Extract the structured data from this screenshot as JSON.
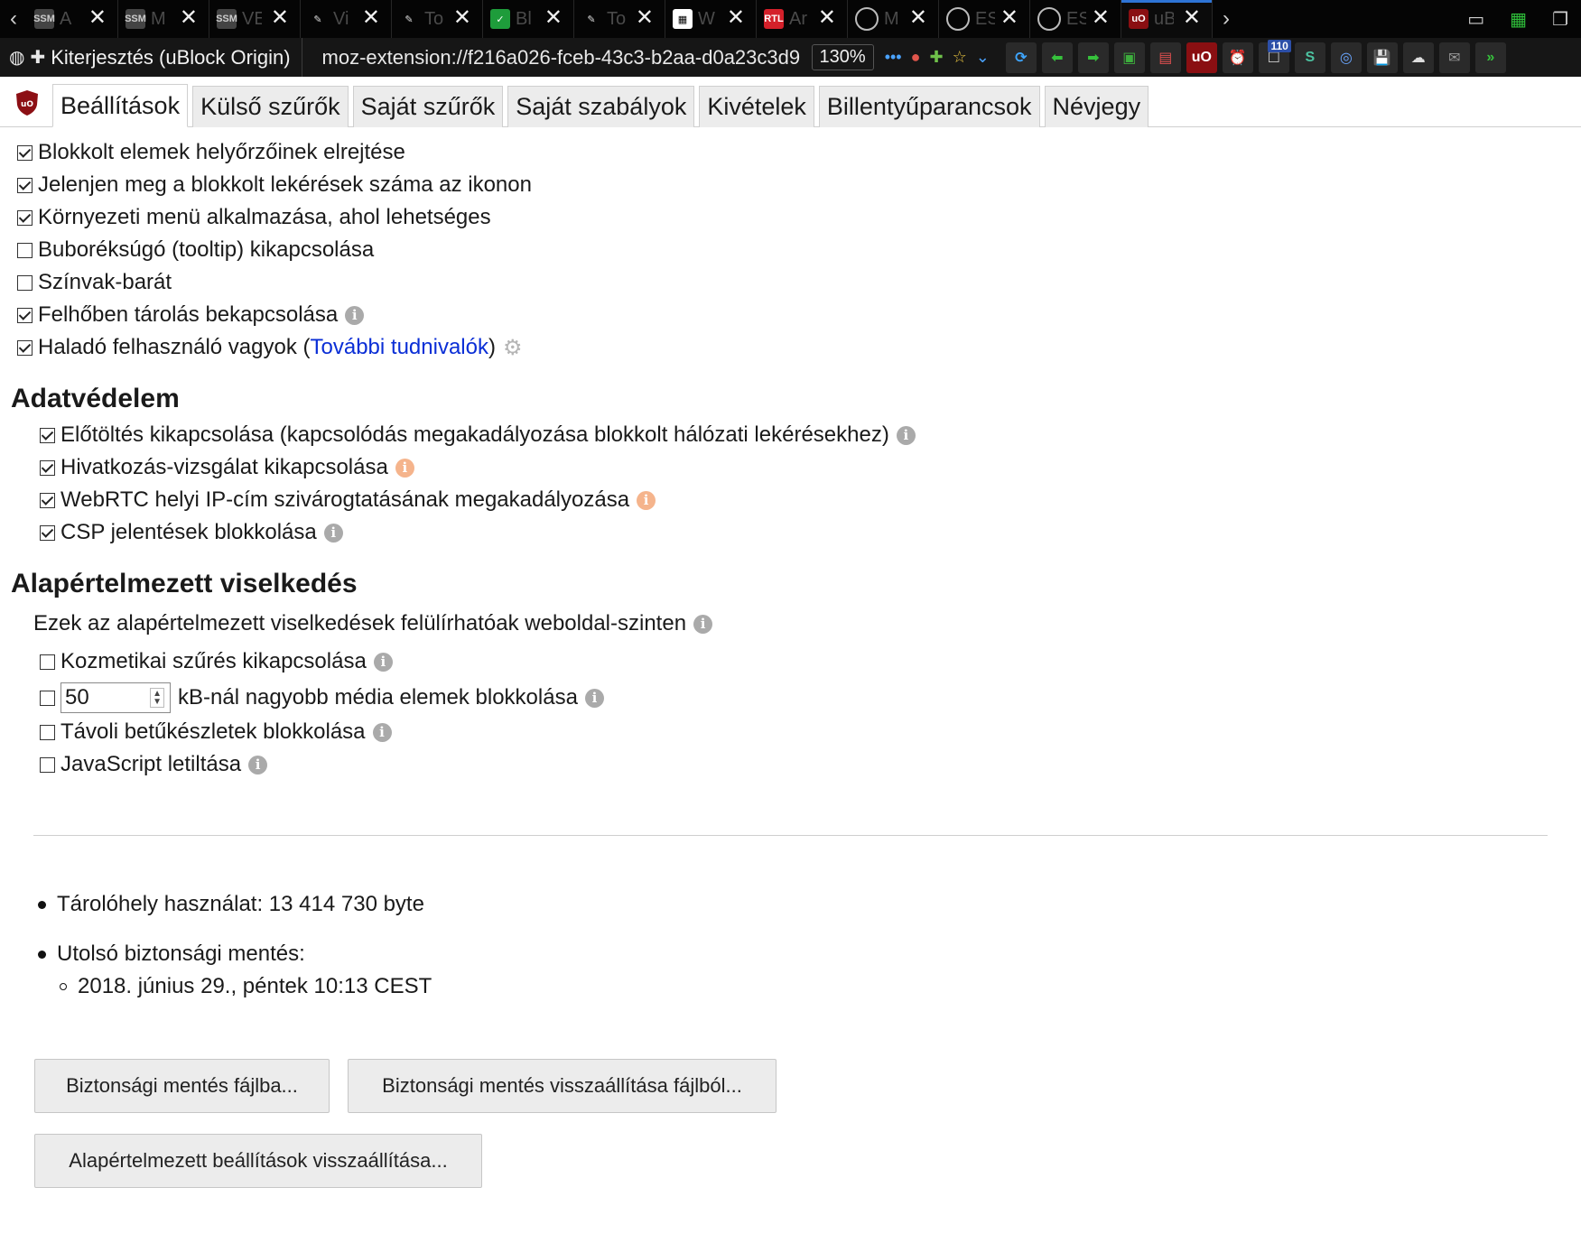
{
  "browser": {
    "tabs": [
      {
        "title": "A",
        "fav": "SSM"
      },
      {
        "title": "M",
        "fav": "SSM"
      },
      {
        "title": "VE",
        "fav": "SSM"
      },
      {
        "title": "Vi",
        "fav": "pin"
      },
      {
        "title": "To",
        "fav": "pin"
      },
      {
        "title": "Bl",
        "fav": "check"
      },
      {
        "title": "To",
        "fav": "pin"
      },
      {
        "title": "W",
        "fav": "qr"
      },
      {
        "title": "Ar",
        "fav": "RTL"
      },
      {
        "title": "M",
        "fav": "circle"
      },
      {
        "title": "ES",
        "fav": "circle"
      },
      {
        "title": "ES",
        "fav": "circle"
      },
      {
        "title": "uB",
        "fav": "uBO"
      }
    ],
    "identity_label": "Kiterjesztés (uBlock Origin)",
    "url": "moz-extension://f216a026-fceb-43c3-b2aa-d0a23c3d9",
    "zoom": "130%",
    "badge_count": "110",
    "overflow_icon": "»"
  },
  "page_tabs": [
    "Beállítások",
    "Külső szűrők",
    "Saját szűrők",
    "Saját szabályok",
    "Kivételek",
    "Billentyűparancsok",
    "Névjegy"
  ],
  "appearance": [
    {
      "label": "Blokkolt elemek helyőrzőinek elrejtése",
      "checked": true
    },
    {
      "label": "Jelenjen meg a blokkolt lekérések száma az ikonon",
      "checked": true
    },
    {
      "label": "Környezeti menü alkalmazása, ahol lehetséges",
      "checked": true
    },
    {
      "label": "Buboréksúgó (tooltip) kikapcsolása",
      "checked": false
    },
    {
      "label": "Színvak-barát",
      "checked": false
    },
    {
      "label": "Felhőben tárolás bekapcsolása",
      "checked": true
    },
    {
      "label_before": "Haladó felhasználó vagyok (",
      "link": "További tudnivalók",
      "label_after": ")",
      "checked": true
    }
  ],
  "privacy": {
    "heading": "Adatvédelem",
    "items": [
      {
        "label": "Előtöltés kikapcsolása (kapcsolódás megakadályozása blokkolt hálózati lekérésekhez)",
        "checked": true
      },
      {
        "label": "Hivatkozás-vizsgálat kikapcsolása",
        "checked": true
      },
      {
        "label": "WebRTC helyi IP-cím szivárogtatásának megakadályozása",
        "checked": true
      },
      {
        "label": "CSP jelentések blokkolása",
        "checked": true
      }
    ]
  },
  "default_behavior": {
    "heading": "Alapértelmezett viselkedés",
    "note": "Ezek az alapértelmezett viselkedések felülírhatóak weboldal-szinten",
    "items": [
      {
        "label": "Kozmetikai szűrés kikapcsolása",
        "checked": false
      },
      {
        "label": "kB-nál nagyobb média elemek blokkolása",
        "checked": false,
        "value": "50"
      },
      {
        "label": "Távoli betűkészletek blokkolása",
        "checked": false
      },
      {
        "label": "JavaScript letiltása",
        "checked": false
      }
    ]
  },
  "storage": {
    "usage": "Tárolóhely használat: 13 414 730 byte",
    "backup_label": "Utolsó biztonsági mentés:",
    "backup_date": "2018. június 29., péntek 10:13 CEST"
  },
  "buttons": {
    "backup": "Biztonsági mentés fájlba...",
    "restore": "Biztonsági mentés visszaállítása fájlból...",
    "reset": "Alapértelmezett beállítások visszaállítása..."
  }
}
